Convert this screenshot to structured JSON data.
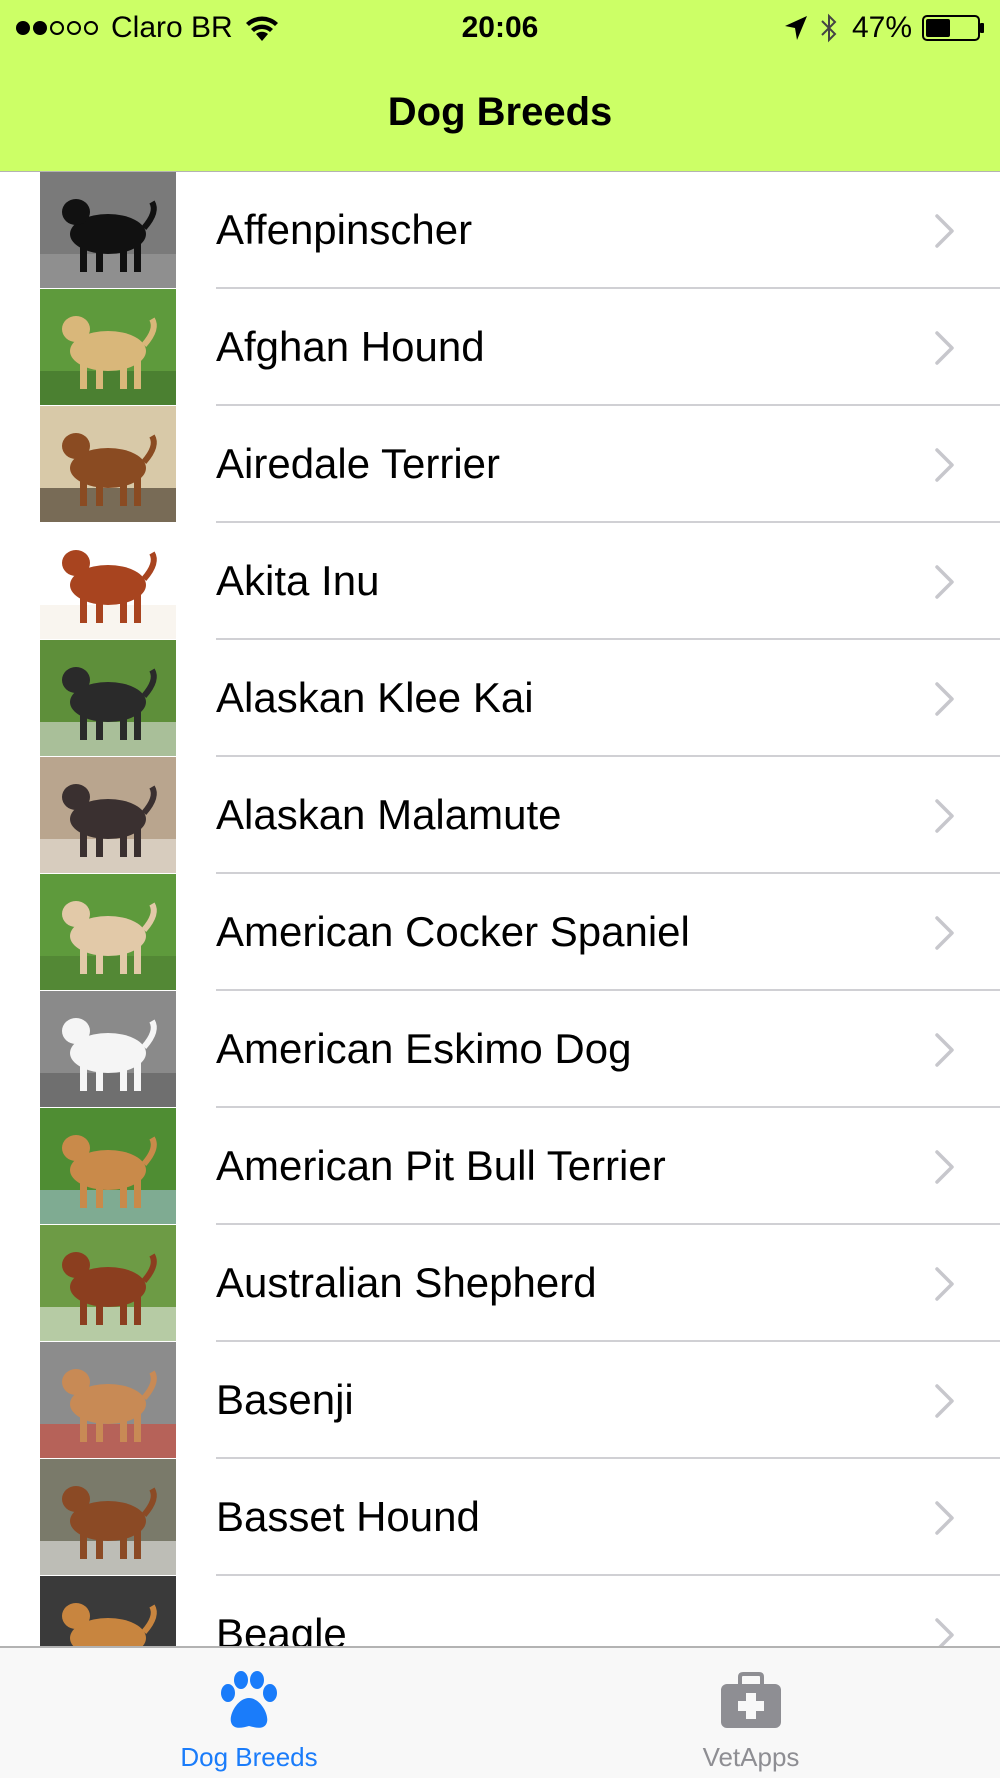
{
  "status_bar": {
    "carrier": "Claro BR",
    "time": "20:06",
    "battery_percent": "47%",
    "battery_level": 0.47,
    "signal_bars_filled": 2,
    "signal_bars_total": 5
  },
  "nav": {
    "title": "Dog Breeds"
  },
  "colors": {
    "nav_background": "#ccff66",
    "tab_active": "#1a7cfa",
    "tab_inactive": "#8e8e93",
    "chevron": "#c7c7cc"
  },
  "breeds": [
    {
      "name": "Affenpinscher"
    },
    {
      "name": "Afghan Hound"
    },
    {
      "name": "Airedale Terrier"
    },
    {
      "name": "Akita Inu"
    },
    {
      "name": "Alaskan Klee Kai"
    },
    {
      "name": "Alaskan Malamute"
    },
    {
      "name": "American Cocker Spaniel"
    },
    {
      "name": "American Eskimo Dog"
    },
    {
      "name": "American Pit Bull Terrier"
    },
    {
      "name": "Australian Shepherd"
    },
    {
      "name": "Basenji"
    },
    {
      "name": "Basset Hound"
    },
    {
      "name": "Beagle"
    }
  ],
  "tabs": [
    {
      "label": "Dog Breeds",
      "icon": "paw-icon",
      "active": true
    },
    {
      "label": "VetApps",
      "icon": "medical-kit-icon",
      "active": false
    }
  ]
}
